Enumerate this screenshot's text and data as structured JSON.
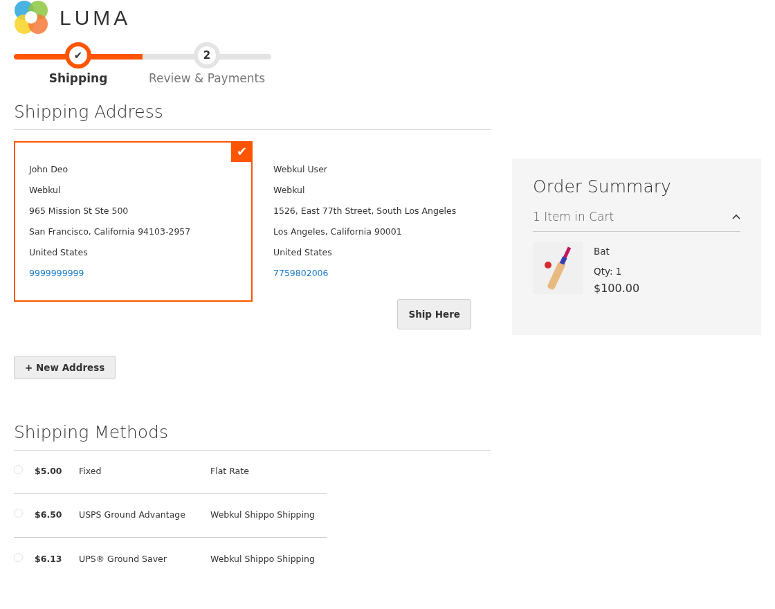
{
  "logo": {
    "text": "LUMA"
  },
  "progress": {
    "steps": [
      {
        "marker": "✔",
        "label": "Shipping",
        "selected": true,
        "done": true
      },
      {
        "marker": "2",
        "label": "Review & Payments",
        "selected": false,
        "done": false
      }
    ]
  },
  "shipping_address": {
    "title": "Shipping Address",
    "addresses": [
      {
        "lines": [
          "John Deo",
          "Webkul",
          "965 Mission St Ste 500",
          "San Francisco, California 94103-2957",
          "United States"
        ],
        "phone": "9999999999",
        "selected": true
      },
      {
        "lines": [
          "Webkul User",
          "Webkul",
          "1526, East 77th Street, South Los Angeles",
          "Los Angeles, California 90001",
          "United States"
        ],
        "phone": "7759802006",
        "selected": false,
        "button": "Ship Here"
      }
    ],
    "new_address_button": "+ New Address"
  },
  "shipping_methods": {
    "title": "Shipping Methods",
    "rows": [
      {
        "price": "$5.00",
        "method": "Fixed",
        "carrier": "Flat Rate",
        "selected": false
      },
      {
        "price": "$6.50",
        "method": "USPS Ground Advantage",
        "carrier": "Webkul Shippo Shipping",
        "selected": false
      },
      {
        "price": "$6.13",
        "method": "UPS® Ground Saver",
        "carrier": "Webkul Shippo Shipping",
        "selected": false
      }
    ]
  },
  "order_summary": {
    "title": "Order Summary",
    "items_count": "1 Item in Cart",
    "expanded": true,
    "items": [
      {
        "name": "Bat",
        "qty": "Qty: 1",
        "price": "$100.00"
      }
    ]
  }
}
